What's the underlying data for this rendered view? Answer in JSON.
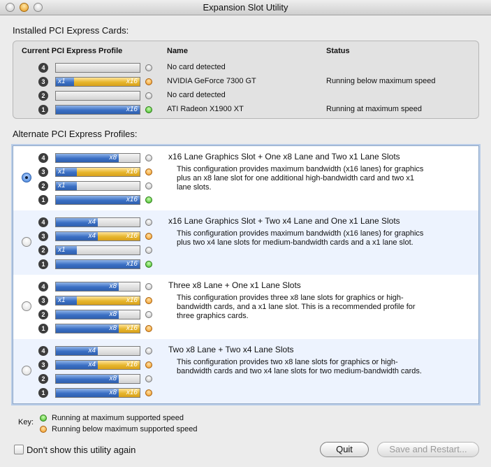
{
  "window": {
    "title": "Expansion Slot Utility"
  },
  "installed": {
    "section_label": "Installed PCI Express Cards:",
    "headers": {
      "profile": "Current PCI Express Profile",
      "name": "Name",
      "status": "Status"
    },
    "rows": [
      {
        "slot": "4",
        "lanes": [],
        "led": "gray",
        "name": "No card detected",
        "status": ""
      },
      {
        "slot": "3",
        "lanes": [
          {
            "label": "x1",
            "color": "blue",
            "f": 0.22
          },
          {
            "label": "x16",
            "color": "gold",
            "f": 0.78
          }
        ],
        "led": "orange",
        "name": "NVIDIA GeForce 7300 GT",
        "status": "Running below maximum speed"
      },
      {
        "slot": "2",
        "lanes": [],
        "led": "gray",
        "name": "No card detected",
        "status": ""
      },
      {
        "slot": "1",
        "lanes": [
          {
            "label": "x16",
            "color": "blue",
            "f": 1.0
          }
        ],
        "led": "green",
        "name": "ATI Radeon X1900 XT",
        "status": "Running at maximum speed"
      }
    ]
  },
  "alternate": {
    "section_label": "Alternate PCI Express Profiles:",
    "profiles": [
      {
        "selected": true,
        "title": "x16 Lane Graphics Slot + One x8 Lane and Two x1 Lane Slots",
        "desc_lines": [
          "This configuration provides maximum bandwidth (x16 lanes) for graphics",
          "plus an x8 lane slot for one additional high-bandwidth card and two x1",
          "lane slots."
        ],
        "slots": [
          {
            "slot": "4",
            "lanes": [
              {
                "label": "x8",
                "color": "blue",
                "f": 0.75
              }
            ],
            "led": "gray"
          },
          {
            "slot": "3",
            "lanes": [
              {
                "label": "x1",
                "color": "blue",
                "f": 0.25
              },
              {
                "label": "x16",
                "color": "gold",
                "f": 0.75
              }
            ],
            "led": "orange"
          },
          {
            "slot": "2",
            "lanes": [
              {
                "label": "x1",
                "color": "blue",
                "f": 0.25
              }
            ],
            "led": "gray"
          },
          {
            "slot": "1",
            "lanes": [
              {
                "label": "x16",
                "color": "blue",
                "f": 1.0
              }
            ],
            "led": "green"
          }
        ]
      },
      {
        "selected": false,
        "title": "x16 Lane Graphics Slot + Two x4 Lane and One x1 Lane Slots",
        "desc_lines": [
          "This configuration provides maximum bandwidth (x16 lanes) for graphics",
          "plus two x4 lane slots for medium-bandwidth cards and a x1 lane slot."
        ],
        "slots": [
          {
            "slot": "4",
            "lanes": [
              {
                "label": "x4",
                "color": "blue",
                "f": 0.5
              }
            ],
            "led": "gray"
          },
          {
            "slot": "3",
            "lanes": [
              {
                "label": "x4",
                "color": "blue",
                "f": 0.5
              },
              {
                "label": "x16",
                "color": "gold",
                "f": 0.5
              }
            ],
            "led": "orange"
          },
          {
            "slot": "2",
            "lanes": [
              {
                "label": "x1",
                "color": "blue",
                "f": 0.25
              }
            ],
            "led": "gray"
          },
          {
            "slot": "1",
            "lanes": [
              {
                "label": "x16",
                "color": "blue",
                "f": 1.0
              }
            ],
            "led": "green"
          }
        ]
      },
      {
        "selected": false,
        "title": "Three x8 Lane + One x1 Lane Slots",
        "desc_lines": [
          "This configuration provides three x8 lane slots for graphics or high-",
          "bandwidth cards, and a x1 lane slot.  This is a recommended profile for",
          "three graphics cards."
        ],
        "slots": [
          {
            "slot": "4",
            "lanes": [
              {
                "label": "x8",
                "color": "blue",
                "f": 0.75
              }
            ],
            "led": "gray"
          },
          {
            "slot": "3",
            "lanes": [
              {
                "label": "x1",
                "color": "blue",
                "f": 0.25
              },
              {
                "label": "x16",
                "color": "gold",
                "f": 0.75
              }
            ],
            "led": "orange"
          },
          {
            "slot": "2",
            "lanes": [
              {
                "label": "x8",
                "color": "blue",
                "f": 0.75
              }
            ],
            "led": "gray"
          },
          {
            "slot": "1",
            "lanes": [
              {
                "label": "x8",
                "color": "blue",
                "f": 0.75
              },
              {
                "label": "x16",
                "color": "gold",
                "f": 0.25
              }
            ],
            "led": "orange"
          }
        ]
      },
      {
        "selected": false,
        "title": "Two x8 Lane + Two x4 Lane Slots",
        "desc_lines": [
          "This configuration provides two x8 lane slots for graphics or high-",
          "bandwidth cards and two x4 lane slots for two medium-bandwidth cards."
        ],
        "slots": [
          {
            "slot": "4",
            "lanes": [
              {
                "label": "x4",
                "color": "blue",
                "f": 0.5
              }
            ],
            "led": "gray"
          },
          {
            "slot": "3",
            "lanes": [
              {
                "label": "x4",
                "color": "blue",
                "f": 0.5
              },
              {
                "label": "x16",
                "color": "gold",
                "f": 0.5
              }
            ],
            "led": "orange"
          },
          {
            "slot": "2",
            "lanes": [
              {
                "label": "x8",
                "color": "blue",
                "f": 0.75
              }
            ],
            "led": "gray"
          },
          {
            "slot": "1",
            "lanes": [
              {
                "label": "x8",
                "color": "blue",
                "f": 0.75
              },
              {
                "label": "x16",
                "color": "gold",
                "f": 0.25
              }
            ],
            "led": "orange"
          }
        ]
      }
    ]
  },
  "key": {
    "label": "Key:",
    "items": [
      {
        "led": "green",
        "text": "Running at maximum supported speed"
      },
      {
        "led": "orange",
        "text": "Running below maximum supported speed"
      }
    ]
  },
  "footer": {
    "checkbox_label": "Don't show this utility again",
    "checkbox_checked": false,
    "quit_label": "Quit",
    "save_label": "Save and Restart..."
  }
}
